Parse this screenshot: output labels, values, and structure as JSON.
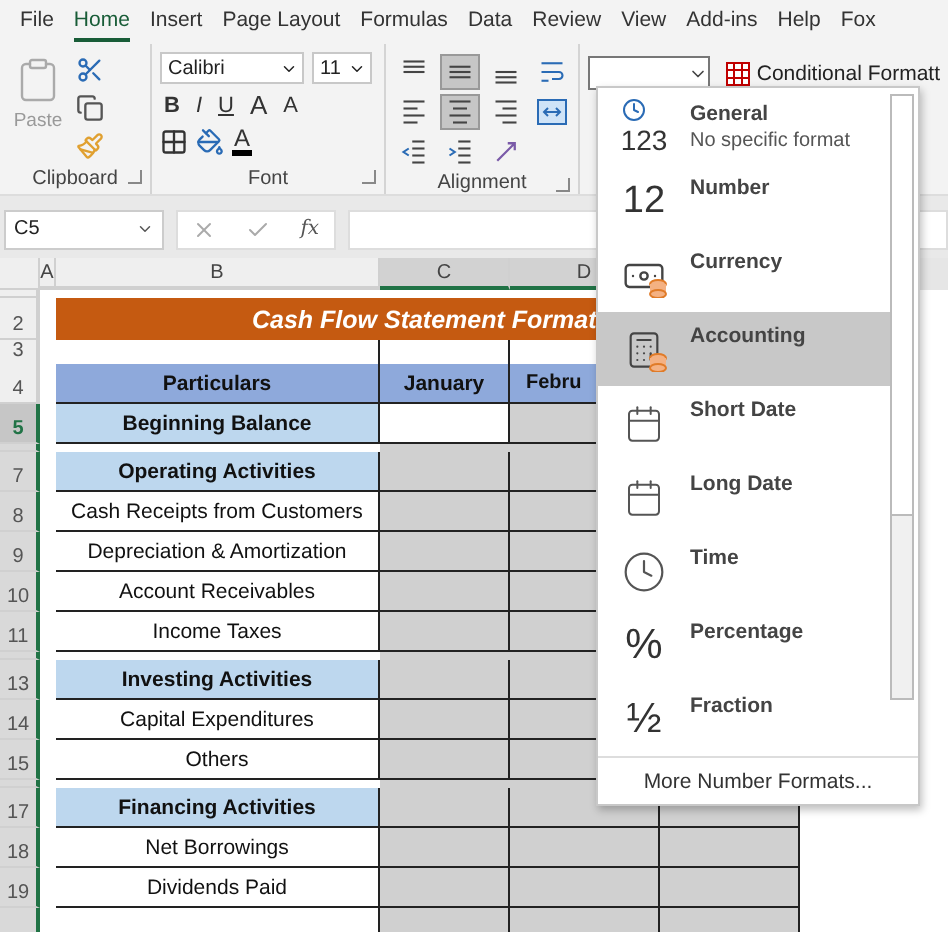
{
  "menu_tabs": [
    {
      "label": "File",
      "selected": false
    },
    {
      "label": "Home",
      "selected": true
    },
    {
      "label": "Insert",
      "selected": false
    },
    {
      "label": "Page Layout",
      "selected": false
    },
    {
      "label": "Formulas",
      "selected": false
    },
    {
      "label": "Data",
      "selected": false
    },
    {
      "label": "Review",
      "selected": false
    },
    {
      "label": "View",
      "selected": false
    },
    {
      "label": "Add-ins",
      "selected": false
    },
    {
      "label": "Help",
      "selected": false
    },
    {
      "label": "Fox",
      "selected": false
    }
  ],
  "ribbon": {
    "paste_label": "Paste",
    "font_name": "Calibri",
    "font_size": "11",
    "style_buttons": [
      "B",
      "I",
      "U"
    ],
    "grow_font": "A",
    "shrink_font": "A",
    "font_color": "A",
    "alignment_buttons": [
      {
        "kind": "top",
        "selected": false
      },
      {
        "kind": "middle",
        "selected": true
      },
      {
        "kind": "bottom",
        "selected": false
      },
      {
        "kind": "wrap",
        "selected": false
      },
      {
        "kind": "left",
        "selected": false
      },
      {
        "kind": "center",
        "selected": true
      },
      {
        "kind": "right",
        "selected": false
      },
      {
        "kind": "merge",
        "selected": false
      },
      {
        "kind": "outdent",
        "selected": false
      },
      {
        "kind": "indent",
        "selected": false
      },
      {
        "kind": "orientation",
        "selected": false
      }
    ],
    "conditional_formatting": "Conditional Formatt",
    "group_labels": [
      "Clipboard",
      "Font",
      "Alignment"
    ]
  },
  "formula_bar": {
    "name_box": "C5",
    "function_label": "fx"
  },
  "columns": [
    {
      "label": "A",
      "selected": false
    },
    {
      "label": "B",
      "selected": false
    },
    {
      "label": "C",
      "selected": true
    },
    {
      "label": "D",
      "selected": true
    }
  ],
  "sheet": {
    "title": "Cash Flow Statement Format",
    "header": {
      "label": "Particulars",
      "months": [
        "January",
        "Febru"
      ]
    },
    "rows": [
      {
        "kind": "gap",
        "selected": false,
        "active": false
      },
      {
        "number": "2",
        "kind": "title",
        "selected": false,
        "active": false
      },
      {
        "number": "3",
        "kind": "blank",
        "selected": false,
        "active": false
      },
      {
        "number": "4",
        "kind": "header",
        "selected": false,
        "active": false
      },
      {
        "number": "5",
        "kind": "section",
        "label": "Beginning Balance",
        "selected": true,
        "active": true
      },
      {
        "kind": "gap",
        "selected": true,
        "active": false
      },
      {
        "number": "7",
        "kind": "section",
        "label": "Operating Activities",
        "selected": true,
        "active": false
      },
      {
        "number": "8",
        "kind": "item",
        "label": "Cash Receipts from Customers",
        "selected": true,
        "active": false
      },
      {
        "number": "9",
        "kind": "item",
        "label": "Depreciation & Amortization",
        "selected": true,
        "active": false
      },
      {
        "number": "10",
        "kind": "item",
        "label": "Account Receivables",
        "selected": true,
        "active": false
      },
      {
        "number": "11",
        "kind": "item",
        "label": "Income Taxes",
        "selected": true,
        "active": false
      },
      {
        "kind": "gap",
        "selected": true,
        "active": false
      },
      {
        "number": "13",
        "kind": "section",
        "label": "Investing Activities",
        "selected": true,
        "active": false
      },
      {
        "number": "14",
        "kind": "item",
        "label": "Capital Expenditures",
        "selected": true,
        "active": false
      },
      {
        "number": "15",
        "kind": "item",
        "label": "Others",
        "selected": true,
        "active": false
      },
      {
        "kind": "gap",
        "selected": true,
        "active": false
      },
      {
        "number": "17",
        "kind": "section",
        "label": "Financing Activities",
        "selected": true,
        "active": false
      },
      {
        "number": "18",
        "kind": "item",
        "label": "Net Borrowings",
        "selected": true,
        "active": false
      },
      {
        "number": "19",
        "kind": "item",
        "label": "Dividends Paid",
        "selected": true,
        "active": false
      },
      {
        "kind": "item",
        "selected": true,
        "active": false
      }
    ]
  },
  "number_format_menu": {
    "items": [
      {
        "kind": "general",
        "glyph": "123",
        "label": "General",
        "description": "No specific format",
        "selected": false
      },
      {
        "kind": "number",
        "glyph": "12",
        "label": "Number",
        "selected": false
      },
      {
        "kind": "currency",
        "label": "Currency",
        "selected": false
      },
      {
        "kind": "accounting",
        "label": "Accounting",
        "selected": true
      },
      {
        "kind": "short_date",
        "label": "Short Date",
        "selected": false
      },
      {
        "kind": "long_date",
        "label": "Long Date",
        "selected": false
      },
      {
        "kind": "time",
        "label": "Time",
        "selected": false
      },
      {
        "kind": "percentage",
        "glyph": "%",
        "label": "Percentage",
        "selected": false
      },
      {
        "kind": "fraction",
        "glyph": "½",
        "label": "Fraction",
        "selected": false
      }
    ],
    "footer": "More Number Formats..."
  }
}
